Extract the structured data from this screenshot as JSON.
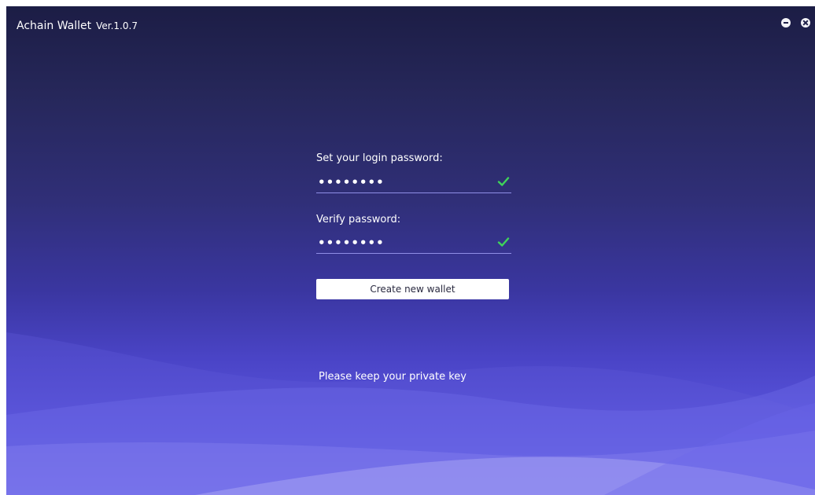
{
  "window": {
    "title": "Achain Wallet",
    "version": "Ver.1.0.7"
  },
  "form": {
    "password_label": "Set your login password:",
    "password_value": "••••••••",
    "verify_label": "Verify password:",
    "verify_value": "••••••••",
    "submit_label": "Create new wallet"
  },
  "footer": {
    "notice": "Please keep your private key"
  },
  "colors": {
    "check": "#3fd35a",
    "button_bg": "#ffffff",
    "field_underline": "#8f8ee6"
  },
  "icons": {
    "minimize": "minimize-icon",
    "close": "close-icon",
    "valid": "check-icon"
  }
}
